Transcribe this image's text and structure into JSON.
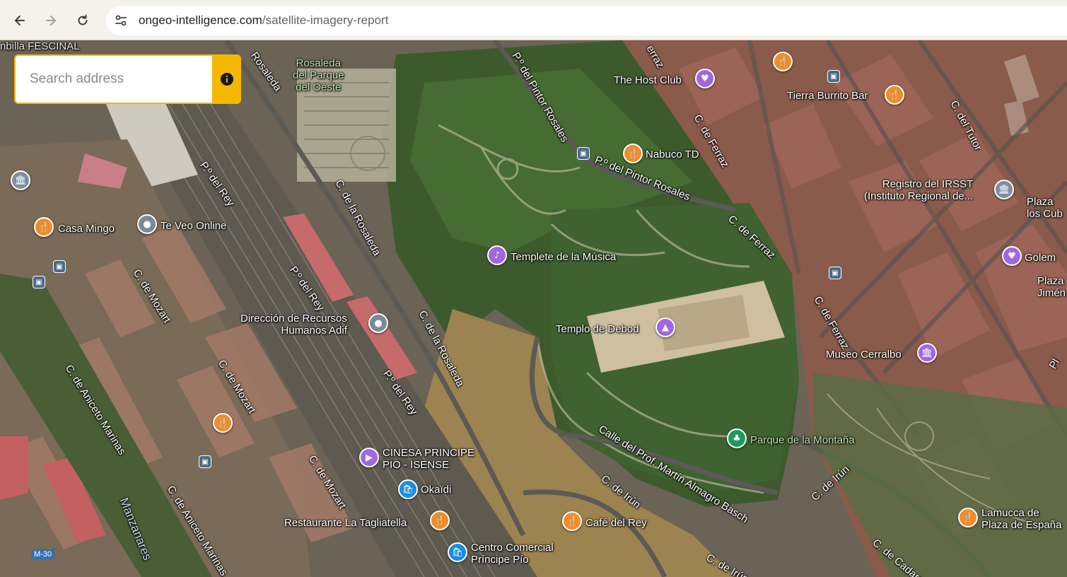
{
  "browser": {
    "url_domain": "ongeo-intelligence.com",
    "url_path": "/satellite-imagery-report",
    "icons": [
      "back-arrow-icon",
      "forward-arrow-icon",
      "reload-icon",
      "site-settings-icon"
    ]
  },
  "search": {
    "placeholder": "Search address",
    "info_icon": "info-icon",
    "accent_color": "#f5b800"
  },
  "map": {
    "type": "satellite",
    "places": {
      "rosaleda": "Rosaleda\ndel Parque\ndel Oeste",
      "host_club": "The Host Club",
      "tierra_burrito": "Tierra Burrito Bar",
      "nabuco": "Nabuco TD",
      "registro": "Registro del IRSST\n(Instituto Regional de...",
      "plaza_cubos": "Plaza\nlos Cub",
      "casa_mingo": "Casa Mingo",
      "te_veo": "Te Veo Online",
      "templete": "Templete de la Música",
      "golem": "Golem",
      "plaza_jimenez": "Plaza\nJimén",
      "direccion": "Dirección de Recursos\nHumanos Adif",
      "templo": "Templo de Debod",
      "museo": "Museo Cerralbo",
      "parque": "Parque de la Montaña",
      "cinesa": "CINESA PRINCIPE\nPIO - ISENSE",
      "okaidi": "Okaïdi",
      "tagliatella": "Restaurante La Tagliatella",
      "cafe_rey": "Café del Rey",
      "centro": "Centro Comercial\nPríncipe Pío",
      "lamucca": "Lamucca de\nPlaza de España",
      "fescinal": "nbilla FESCINAL"
    },
    "streets": {
      "rosaleda": "Rosaleda",
      "pintor_top": "P.º del Pintor Rosales",
      "pintor_mid": "P.º del Pintor Rosales",
      "ferraz_top": "C. de Ferraz",
      "ferraz_mid": "C. de Ferraz",
      "ferraz_right": "C. de Ferraz",
      "ferraz_partial": "erraz",
      "tutor": "C. del Tutor",
      "rey_1": "P.º del Rey",
      "rey_2": "P.º del Rey",
      "rey_3": "P.º del Rey",
      "rosaleda_1": "C. de la Rosaleda",
      "rosaleda_2": "C. de la Rosaleda",
      "mozart_1": "C. de Mozart",
      "mozart_2": "C. de Mozart",
      "mozart_3": "C. de Mozart",
      "aniceto_1": "C. de Aniceto Marinas",
      "aniceto_2": "C. de Aniceto Marinas",
      "manzanares": "Manzanares",
      "almagro": "Calle del Prof. Martín Almagro Basch",
      "irun_1": "C. de Irún",
      "irun_2": "C. de Irún",
      "irun_3": "C. de Irún",
      "cadarso": "C. de Cadars",
      "pl": "Pl",
      "m30": "M-30"
    }
  }
}
